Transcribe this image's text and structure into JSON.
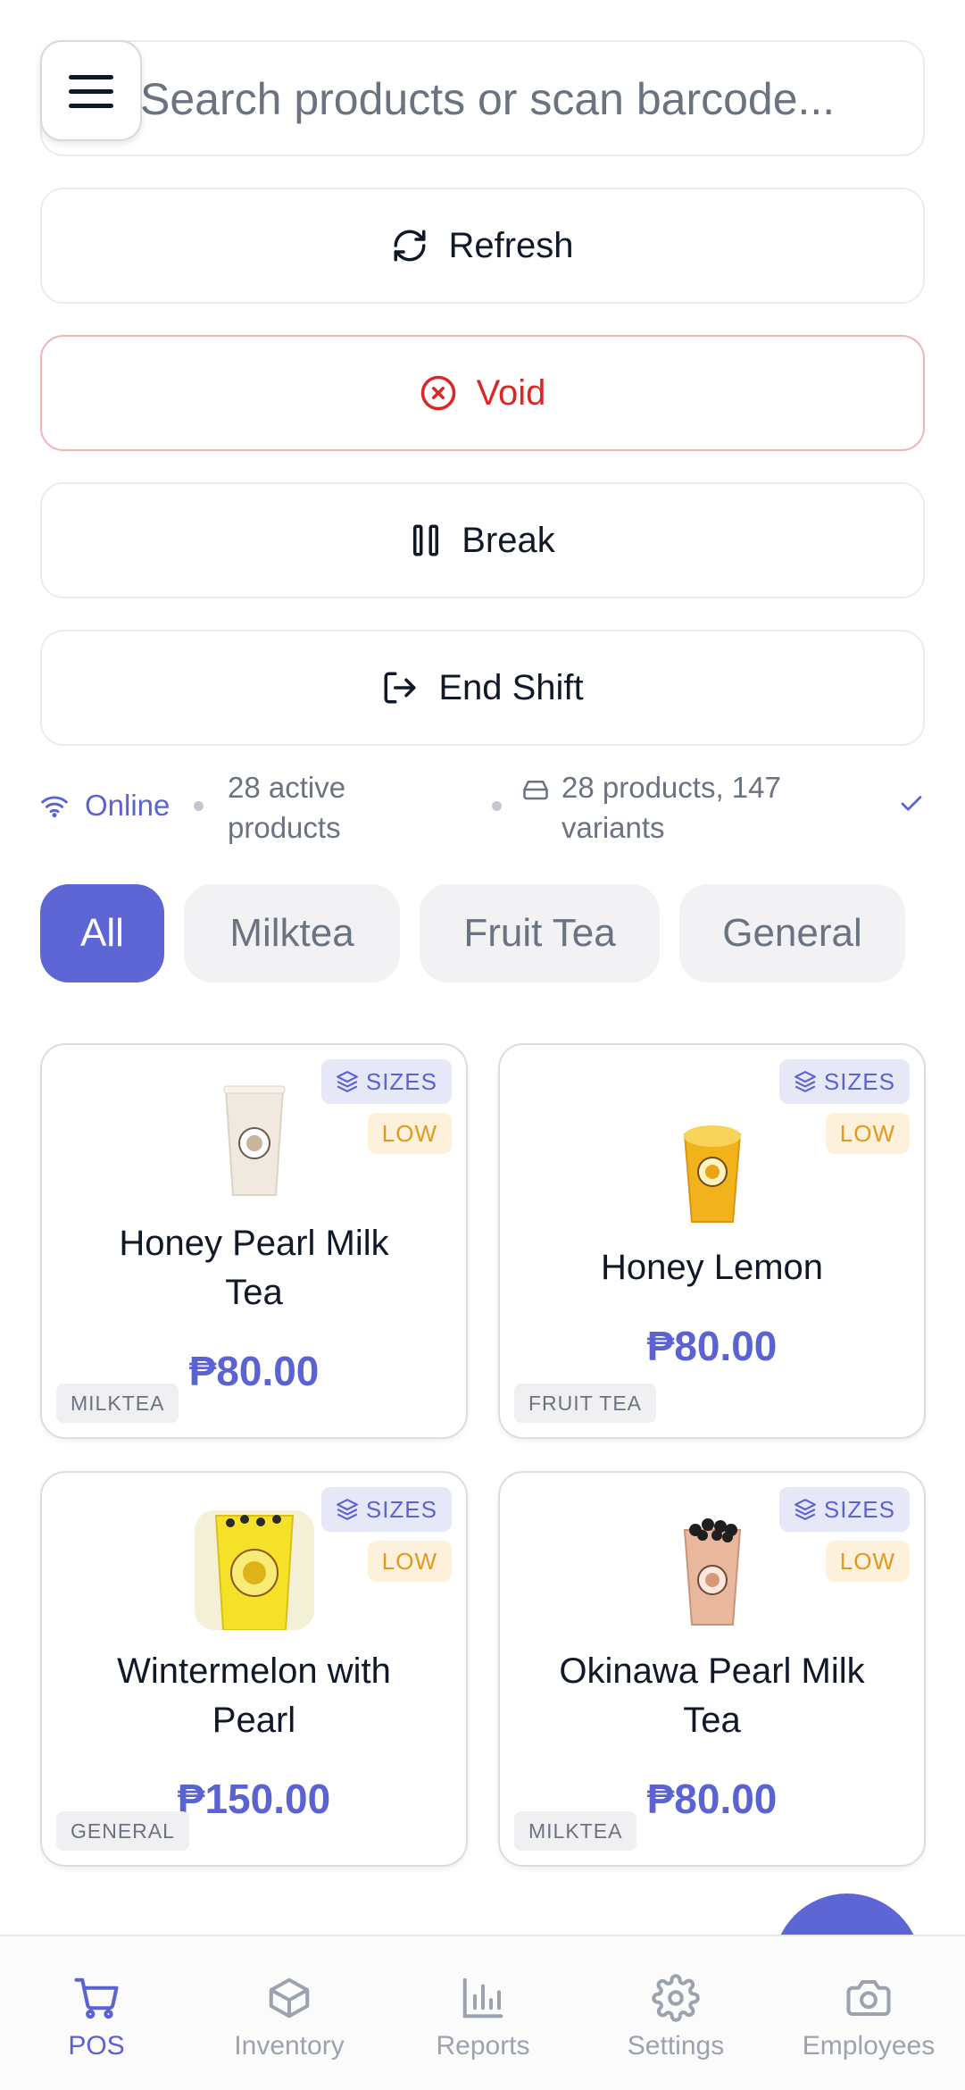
{
  "search": {
    "placeholder": "Search products or scan barcode..."
  },
  "actions": {
    "refresh": "Refresh",
    "void": "Void",
    "break": "Break",
    "end_shift": "End Shift"
  },
  "status": {
    "online": "Online",
    "active_line1": "28 active",
    "active_line2": "products",
    "variants_line1": "28 products, 147",
    "variants_line2": "variants"
  },
  "categories": [
    "All",
    "Milktea",
    "Fruit Tea",
    "General"
  ],
  "products": [
    {
      "name_line1": "Honey Pearl Milk",
      "name_line2": "Tea",
      "price": "₱80.00",
      "category": "MILKTEA",
      "sizes": "SIZES",
      "stock": "LOW"
    },
    {
      "name_line1": "Honey Lemon",
      "name_line2": "",
      "price": "₱80.00",
      "category": "FRUIT TEA",
      "sizes": "SIZES",
      "stock": "LOW"
    },
    {
      "name_line1": "Wintermelon with",
      "name_line2": "Pearl",
      "price": "₱150.00",
      "category": "GENERAL",
      "sizes": "SIZES",
      "stock": "LOW"
    },
    {
      "name_line1": "Okinawa Pearl Milk",
      "name_line2": "Tea",
      "price": "₱80.00",
      "category": "MILKTEA",
      "sizes": "SIZES",
      "stock": "LOW"
    }
  ],
  "nav": [
    "POS",
    "Inventory",
    "Reports",
    "Settings",
    "Employees"
  ],
  "colors": {
    "accent": "#5d66d4",
    "danger": "#dc2626",
    "warning": "#e09a1c"
  }
}
